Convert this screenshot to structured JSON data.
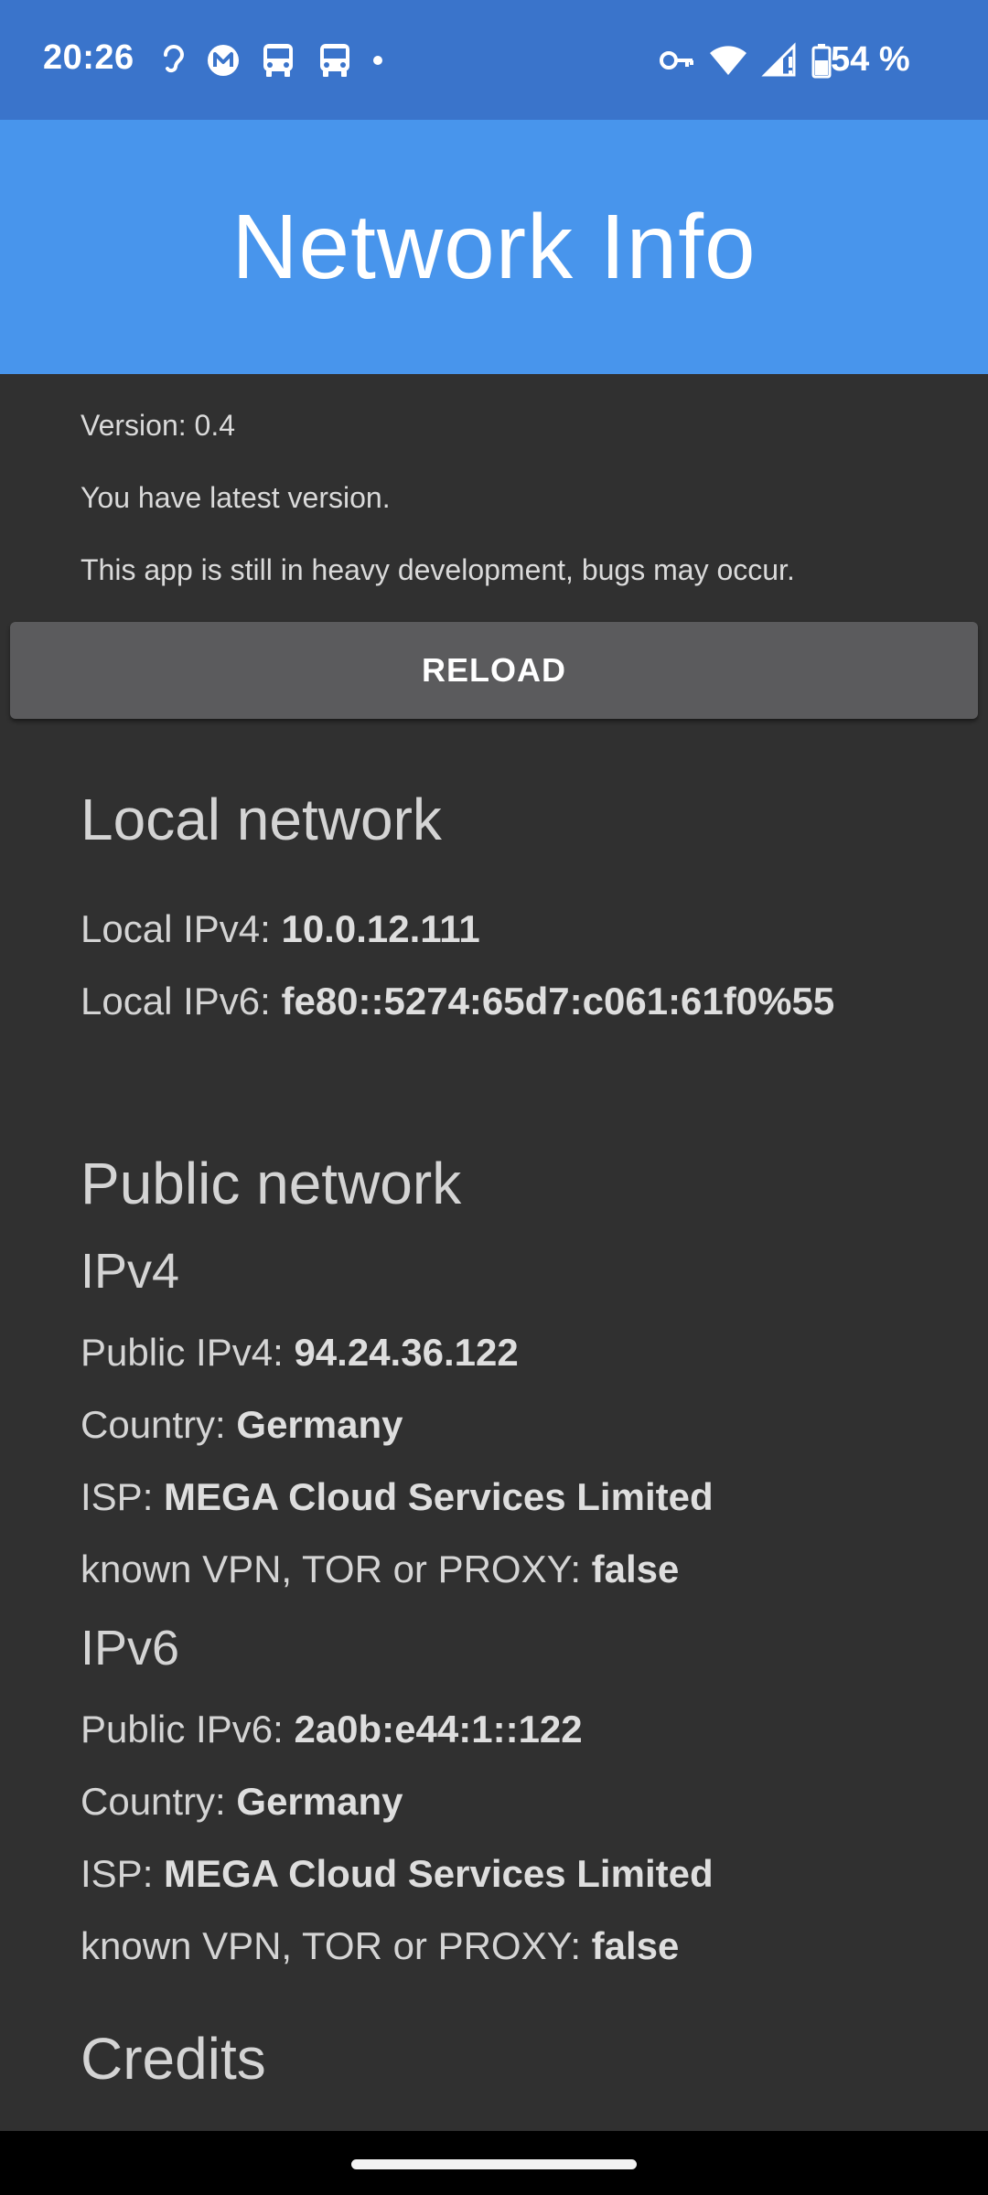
{
  "status_bar": {
    "time": "20:26",
    "battery": "54 %",
    "left_icons": [
      "hearing-aid-icon",
      "mega-icon",
      "bus-icon",
      "bus-icon",
      "dot-icon"
    ],
    "right_icons": [
      "vpn-key-icon",
      "wifi-icon",
      "signal-icon",
      "battery-icon"
    ]
  },
  "app_bar": {
    "title": "Network Info"
  },
  "info": {
    "version": "Version: 0.4",
    "update_status": "You have latest version.",
    "dev_notice": "This app is still in heavy development, bugs may occur."
  },
  "reload_button": {
    "label": "RELOAD"
  },
  "local_network": {
    "title": "Local network",
    "ipv4_label": "Local IPv4: ",
    "ipv4_value": "10.0.12.111",
    "ipv6_label": "Local IPv6: ",
    "ipv6_value": "fe80::5274:65d7:c061:61f0%55"
  },
  "public_network": {
    "title": "Public network",
    "ipv4": {
      "title": "IPv4",
      "ip_label": "Public IPv4: ",
      "ip_value": "94.24.36.122",
      "country_label": "Country: ",
      "country_value": "Germany",
      "isp_label": "ISP: ",
      "isp_value": "MEGA Cloud Services Limited",
      "vpn_label": "known VPN, TOR or PROXY: ",
      "vpn_value": "false"
    },
    "ipv6": {
      "title": "IPv6",
      "ip_label": "Public IPv6: ",
      "ip_value": "2a0b:e44:1::122",
      "country_label": "Country: ",
      "country_value": "Germany",
      "isp_label": "ISP: ",
      "isp_value": "MEGA Cloud Services Limited",
      "vpn_label": "known VPN, TOR or PROXY: ",
      "vpn_value": "false"
    }
  },
  "credits": {
    "title": "Credits"
  },
  "colors": {
    "status_bar": "#3a74cb",
    "app_bar": "#4895ec",
    "background": "#303030",
    "button": "#5b5b5d"
  }
}
